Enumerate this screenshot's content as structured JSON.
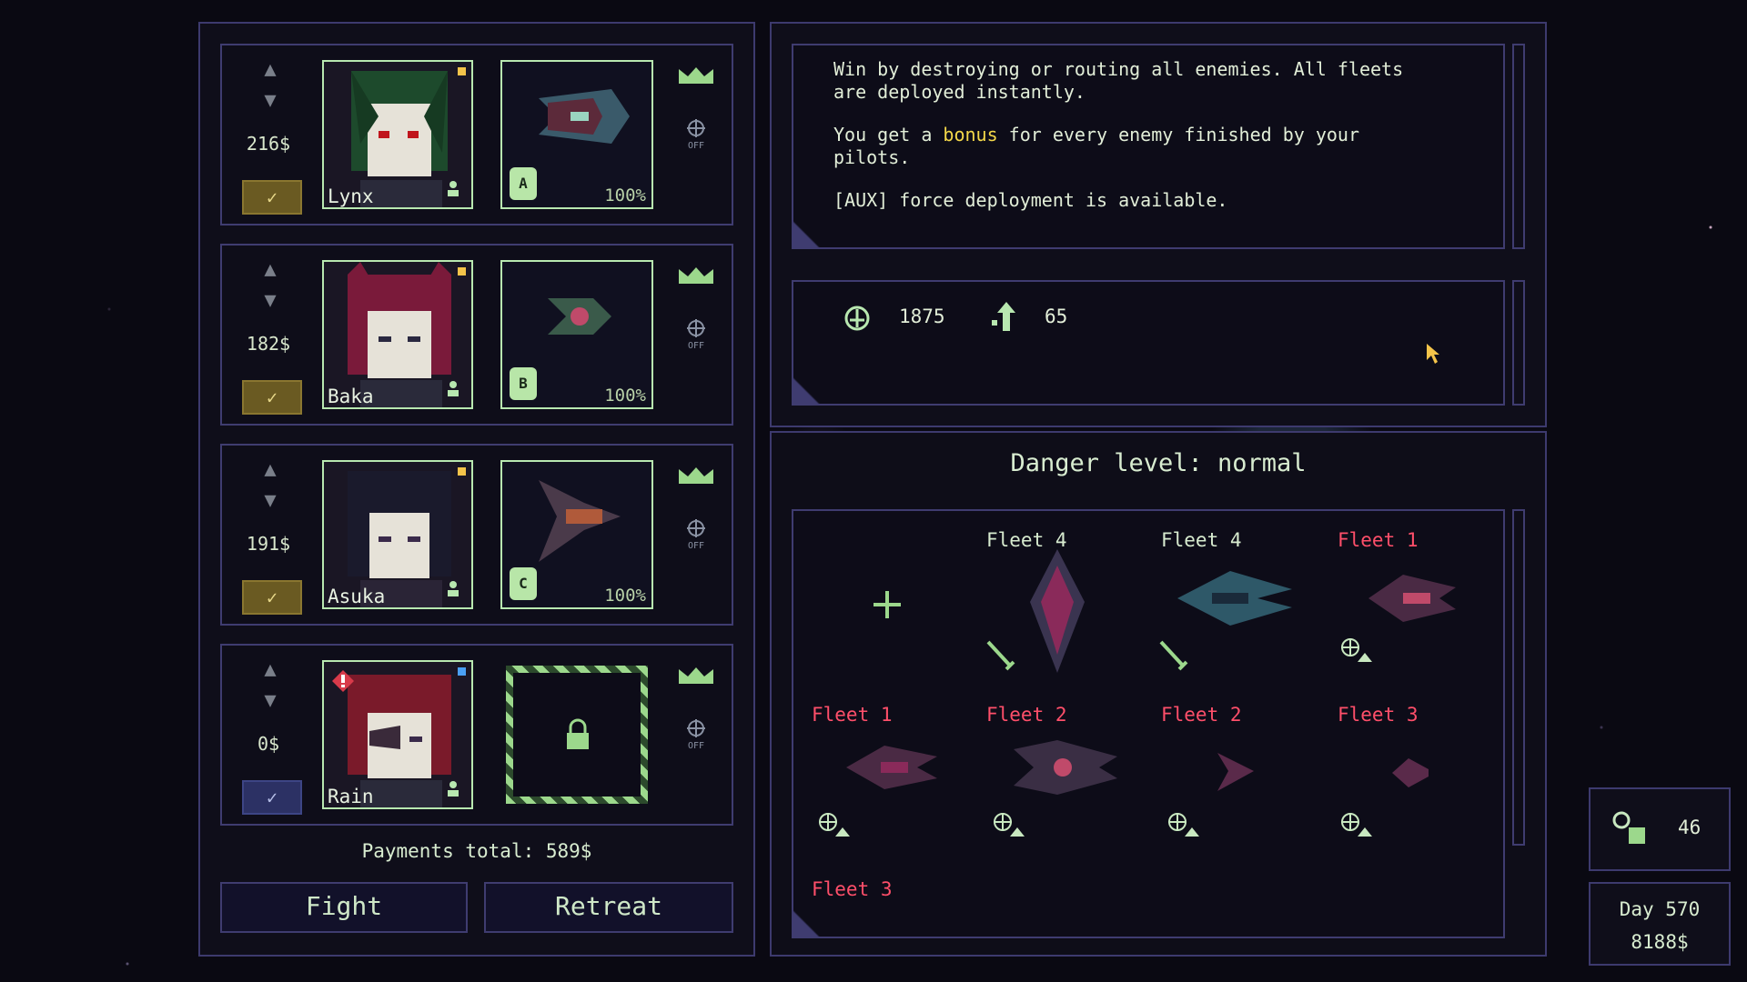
{
  "pilots": [
    {
      "name": "Lynx",
      "payment": "216$",
      "ship_badge": "A",
      "condition": "100%",
      "dot_color": "#f4c44a",
      "hair": "#1d4a2c",
      "selected": true
    },
    {
      "name": "Baka",
      "payment": "182$",
      "ship_badge": "B",
      "condition": "100%",
      "dot_color": "#f4c44a",
      "hair": "#7a1a3a",
      "selected": true
    },
    {
      "name": "Asuka",
      "payment": "191$",
      "ship_badge": "C",
      "condition": "100%",
      "dot_color": "#f4c44a",
      "hair": "#1a1a2c",
      "selected": true
    },
    {
      "name": "Rain",
      "payment": "0$",
      "ship_badge": "",
      "condition": "",
      "dot_color": "#4aa0f4",
      "hair": "#7a1a2a",
      "selected": false,
      "locked": true,
      "warning": true
    }
  ],
  "payments_total": "Payments total: 589$",
  "buttons": {
    "fight": "Fight",
    "retreat": "Retreat"
  },
  "mission": {
    "line1": "Win by destroying or routing all enemies. All fleets",
    "line2": "are deployed instantly.",
    "line3_a": "You get a ",
    "line3_bonus": "bonus",
    "line3_b": " for every enemy finished by your",
    "line4": "pilots.",
    "line5": "[AUX] force deployment is available."
  },
  "stats": {
    "strength": "1875",
    "upgrade": "65"
  },
  "danger": "Danger level: normal",
  "fleets": [
    {
      "label": "Fleet 4",
      "side": "ally"
    },
    {
      "label": "Fleet 4",
      "side": "ally"
    },
    {
      "label": "Fleet 1",
      "side": "enemy"
    },
    {
      "label": "Fleet 1",
      "side": "enemy"
    },
    {
      "label": "Fleet 2",
      "side": "enemy"
    },
    {
      "label": "Fleet 2",
      "side": "enemy"
    },
    {
      "label": "Fleet 3",
      "side": "enemy"
    },
    {
      "label": "Fleet 3",
      "side": "enemy"
    }
  ],
  "resources": {
    "parts": "46",
    "day": "Day 570",
    "money": "8188$"
  },
  "icons": {
    "add": "plus-icon",
    "lock": "lock-icon",
    "crown": "crown-icon",
    "off": "off-target-icon"
  }
}
